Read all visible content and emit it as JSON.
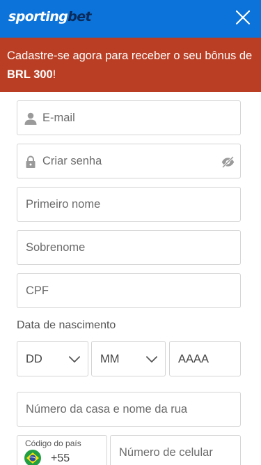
{
  "header": {
    "logo_main": "sporting",
    "logo_accent": "bet",
    "close_icon": "close-icon",
    "background": "#0b73d9"
  },
  "banner": {
    "text_prefix": "Cadastre-se agora para receber o seu bônus de ",
    "bonus": "BRL 300",
    "text_suffix": "!",
    "background": "#b93e23"
  },
  "form": {
    "email_placeholder": "E-mail",
    "password_placeholder": "Criar senha",
    "first_name_placeholder": "Primeiro nome",
    "last_name_placeholder": "Sobrenome",
    "cpf_placeholder": "CPF",
    "dob_label": "Data de nascimento",
    "dob_day": "DD",
    "dob_month": "MM",
    "dob_year": "AAAA",
    "address_placeholder": "Número da casa e nome da rua",
    "country_code_label": "Código do país",
    "country_code_value": "+55",
    "phone_placeholder": "Número de celular"
  },
  "icons": {
    "email": "user-icon",
    "password": "lock-icon",
    "toggle_visibility": "eye-slash-icon",
    "dropdown": "chevron-down-icon",
    "flag": "brazil-flag-icon"
  }
}
